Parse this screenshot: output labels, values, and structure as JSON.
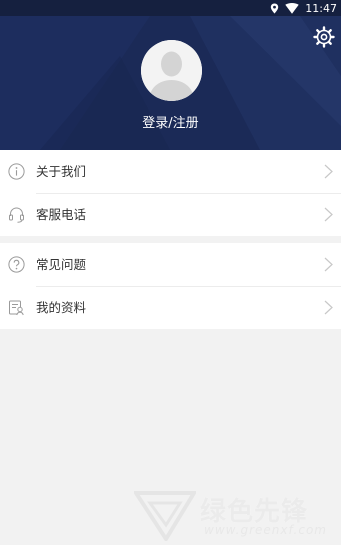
{
  "status_bar": {
    "time": "11:47"
  },
  "header": {
    "login_label": "登录/注册"
  },
  "menu_groups": [
    {
      "items": [
        {
          "label": "关于我们",
          "icon": "info-icon"
        },
        {
          "label": "客服电话",
          "icon": "headset-icon"
        }
      ]
    },
    {
      "items": [
        {
          "label": "常见问题",
          "icon": "question-icon"
        },
        {
          "label": "我的资料",
          "icon": "profile-card-icon"
        }
      ]
    }
  ],
  "watermark": {
    "text": "绿色先锋",
    "url": "www.greenxf.com"
  },
  "colors": {
    "header_bg": "#1b2a57",
    "page_bg": "#f2f2f2",
    "row_bg": "#ffffff"
  }
}
